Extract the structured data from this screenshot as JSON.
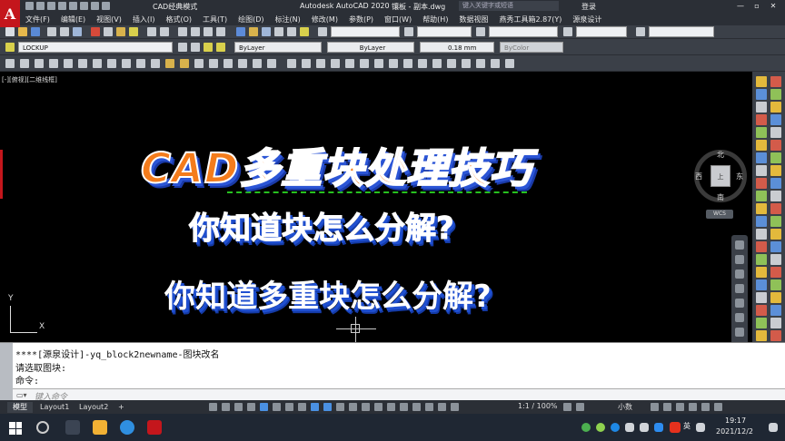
{
  "titlebar": {
    "logo": "A",
    "workspace": "CAD经典模式",
    "app_title": "Autodesk AutoCAD 2020",
    "file_name": "镶板 - 副本.dwg",
    "search_placeholder": "键入关键字或短语",
    "login": "登录",
    "controls": [
      "—",
      "▫",
      "✕"
    ]
  },
  "menu": [
    "文件(F)",
    "编辑(E)",
    "视图(V)",
    "插入(I)",
    "格式(O)",
    "工具(T)",
    "绘图(D)",
    "标注(N)",
    "修改(M)",
    "参数(P)",
    "窗口(W)",
    "帮助(H)",
    "数据视图",
    "燕秀工具箱2.87(Y)",
    "源泉设计"
  ],
  "toolbar": {
    "layer_name": "LOCKUP",
    "color": "ByLayer",
    "linetype": "ByLayer",
    "lineweight": "0.18 mm",
    "plotstyle": "ByColor"
  },
  "viewport": {
    "label": "[-][俯视][二维线框]",
    "title": "CAD多重块处理技巧",
    "question1": "你知道块怎么分解?",
    "question2": "你知道多重块怎么分解?",
    "ucs_x": "X",
    "ucs_y": "Y"
  },
  "viewcube": {
    "north": "北",
    "south": "南",
    "west": "西",
    "east": "东",
    "center": "上",
    "wcs": "WCS"
  },
  "command": {
    "history": [
      "****[源泉设计]-yq_block2newname-图块改名",
      "请选取图块:",
      "命令:"
    ],
    "placeholder": "键入命令"
  },
  "statusbar": {
    "tabs": [
      "模型",
      "Layout1",
      "Layout2"
    ],
    "add_tab": "+",
    "scale": "1:1 / 100%",
    "units": "小数"
  },
  "taskbar": {
    "ime": "英",
    "time": "19:17",
    "date": "2021/12/2"
  },
  "colors": {
    "title_orange": "#f47c1c",
    "shadow_blue": "#2b55d6",
    "autocad_red": "#c4161c"
  }
}
